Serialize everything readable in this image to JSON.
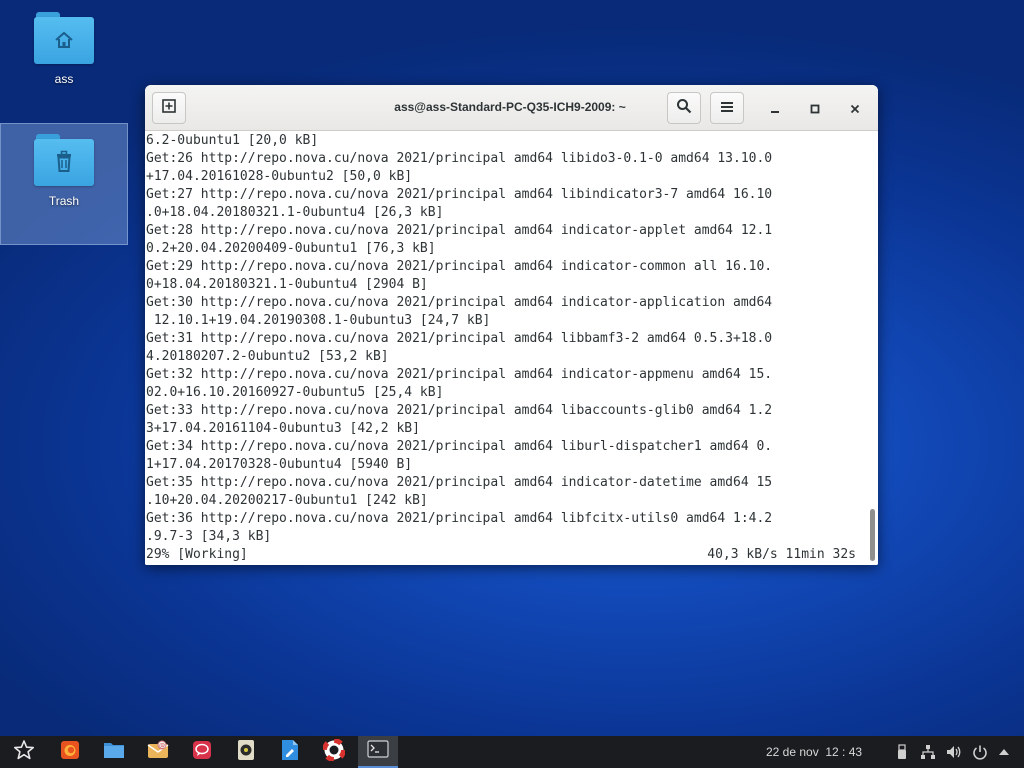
{
  "desktop": {
    "icons": [
      {
        "label": "ass",
        "icon": "home-folder-icon"
      },
      {
        "label": "Trash",
        "icon": "trash-icon"
      }
    ]
  },
  "window": {
    "title": "ass@ass-Standard-PC-Q35-ICH9-2009: ~",
    "buttons": [
      "new-tab-icon",
      "search-icon",
      "menu-icon",
      "minimize-icon",
      "maximize-icon",
      "close-icon"
    ]
  },
  "terminal": {
    "lines": [
      "6.2-0ubuntu1 [20,0 kB]",
      "Get:26 http://repo.nova.cu/nova 2021/principal amd64 libido3-0.1-0 amd64 13.10.0",
      "+17.04.20161028-0ubuntu2 [50,0 kB]",
      "Get:27 http://repo.nova.cu/nova 2021/principal amd64 libindicator3-7 amd64 16.10",
      ".0+18.04.20180321.1-0ubuntu4 [26,3 kB]",
      "Get:28 http://repo.nova.cu/nova 2021/principal amd64 indicator-applet amd64 12.1",
      "0.2+20.04.20200409-0ubuntu1 [76,3 kB]",
      "Get:29 http://repo.nova.cu/nova 2021/principal amd64 indicator-common all 16.10.",
      "0+18.04.20180321.1-0ubuntu4 [2904 B]",
      "Get:30 http://repo.nova.cu/nova 2021/principal amd64 indicator-application amd64",
      " 12.10.1+19.04.20190308.1-0ubuntu3 [24,7 kB]",
      "Get:31 http://repo.nova.cu/nova 2021/principal amd64 libbamf3-2 amd64 0.5.3+18.0",
      "4.20180207.2-0ubuntu2 [53,2 kB]",
      "Get:32 http://repo.nova.cu/nova 2021/principal amd64 indicator-appmenu amd64 15.",
      "02.0+16.10.20160927-0ubuntu5 [25,4 kB]",
      "Get:33 http://repo.nova.cu/nova 2021/principal amd64 libaccounts-glib0 amd64 1.2",
      "3+17.04.20161104-0ubuntu3 [42,2 kB]",
      "Get:34 http://repo.nova.cu/nova 2021/principal amd64 liburl-dispatcher1 amd64 0.",
      "1+17.04.20170328-0ubuntu4 [5940 B]",
      "Get:35 http://repo.nova.cu/nova 2021/principal amd64 indicator-datetime amd64 15",
      ".10+20.04.20200217-0ubuntu1 [242 kB]",
      "Get:36 http://repo.nova.cu/nova 2021/principal amd64 libfcitx-utils0 amd64 1:4.2",
      ".9.7-3 [34,3 kB]"
    ],
    "status_left": "29% [Working]",
    "status_right": "40,3 kB/s 11min 32s"
  },
  "taskbar": {
    "apps": [
      "app-menu-star-icon",
      "firefox-icon",
      "file-manager-icon",
      "mail-icon",
      "chat-icon",
      "media-player-icon",
      "text-editor-icon",
      "help-lifebuoy-icon",
      "terminal-icon"
    ],
    "clock": "22 de nov  12 : 43",
    "tray": [
      "usb-icon",
      "network-icon",
      "volume-icon",
      "power-icon",
      "tray-expand-icon"
    ]
  }
}
